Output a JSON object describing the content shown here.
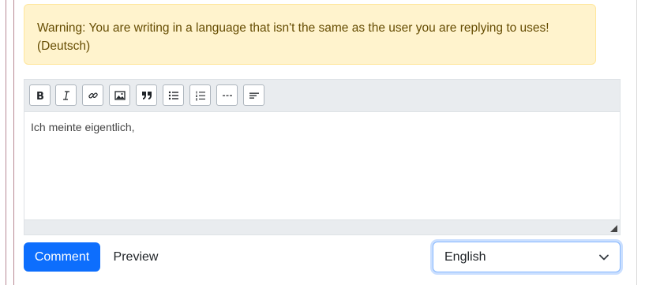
{
  "warning": {
    "text": "Warning: You are writing in a language that isn't the same as the user you are replying to uses! (Deutsch)"
  },
  "toolbar": {
    "buttons": [
      {
        "icon": "bold-icon"
      },
      {
        "icon": "italic-icon"
      },
      {
        "icon": "link-icon"
      },
      {
        "icon": "image-icon"
      },
      {
        "icon": "quote-icon"
      },
      {
        "icon": "bulleted-list-icon"
      },
      {
        "icon": "numbered-list-icon"
      },
      {
        "icon": "horizontal-rule-icon"
      },
      {
        "icon": "spoiler-icon"
      }
    ]
  },
  "editor": {
    "content": "Ich meinte eigentlich,"
  },
  "actions": {
    "comment_label": "Comment",
    "preview_label": "Preview"
  },
  "language_select": {
    "selected": "English"
  },
  "colors": {
    "primary": "#0d6efd",
    "warning_bg": "#fff3cd",
    "warning_text": "#664d03"
  }
}
